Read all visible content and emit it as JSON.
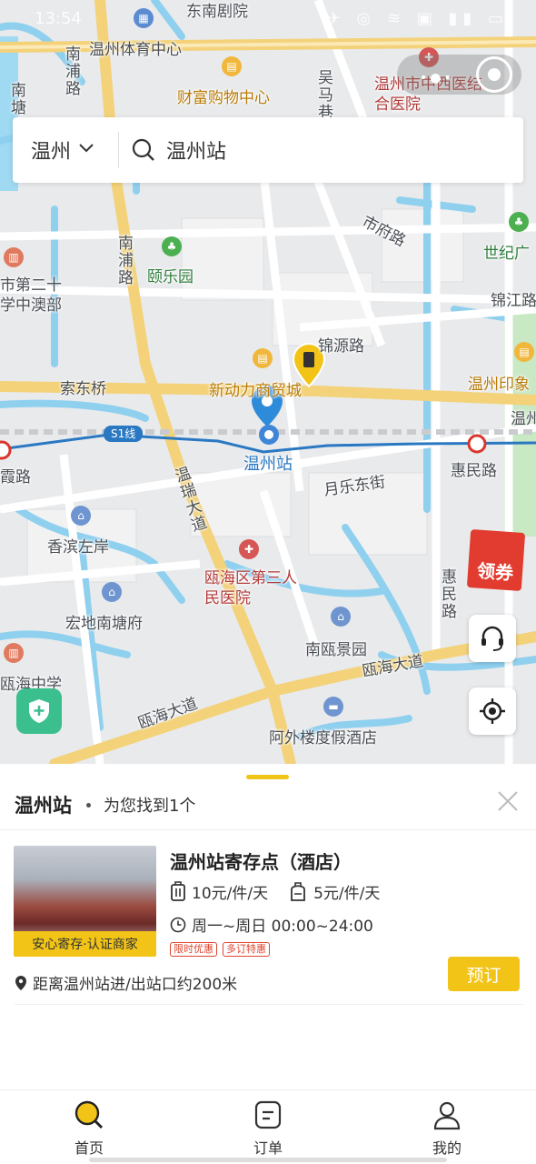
{
  "status_bar": {
    "time": "13:54",
    "icons": "✈ ◎ ≋ ▣ ▮▮ ▭"
  },
  "search": {
    "city": "温州",
    "query": "温州站"
  },
  "map": {
    "labels": {
      "dongnan_theater": "东南剧院",
      "sports_center": "温州体育中心",
      "caifu_mall": "财富购物中心",
      "hospital_tcm": "温州市中西医结合医院",
      "nanpu_road_top": "南浦路",
      "nantang": "南塘",
      "nanpu_road": "南浦路",
      "shifu_road": "市府路",
      "century_park": "世纪广",
      "yile_garden": "颐乐园",
      "school_no20": "市第二十学中澳部",
      "jinjiang_road": "锦江路",
      "jinyuan_road": "锦源路",
      "xindongli_mall": "新动力商贸城",
      "suodong_bridge": "索东桥",
      "wenzhou_impression": "温州印象",
      "wenzhou_right": "温州",
      "line_s1": "S1线",
      "wenzhou_station": "温州站",
      "huimin_road": "惠民路",
      "xia_road": "霞路",
      "yuele_east_st": "月乐东街",
      "wenrui_avenue": "温瑞大道",
      "xiangbin_zuoan": "香滨左岸",
      "hospital_ouhai": "瓯海区第三人民医院",
      "huimin_road_v": "惠民路",
      "hongdi_nantang": "宏地南塘府",
      "nanou_jingyuan": "南瓯景园",
      "ouhai_middle_school": "瓯海中学",
      "ouhai_avenue_right": "瓯海大道",
      "ouhai_avenue_left": "瓯海大道",
      "awaylou_hotel": "阿外楼度假酒店",
      "wuma_road": "吴马巷"
    }
  },
  "coupon": {
    "label": "领券"
  },
  "result": {
    "keyword": "温州站",
    "found_text": "为您找到1个",
    "item": {
      "title": "温州站寄存点（酒店）",
      "badge": "安心寄存·认证商家",
      "price_large": "10元/件/天",
      "price_small": "5元/件/天",
      "hours": "周一~周日 00:00~24:00",
      "tags": [
        "限时优惠",
        "多订特惠"
      ],
      "distance": "距离温州站进/出站口约200米",
      "book_label": "预订"
    }
  },
  "tabs": [
    {
      "label": "首页",
      "icon": "search-icon",
      "active": true
    },
    {
      "label": "订单",
      "icon": "order-icon",
      "active": false
    },
    {
      "label": "我的",
      "icon": "user-icon",
      "active": false
    }
  ],
  "colors": {
    "accent": "#f2c417",
    "metro_line": "#2a78c2",
    "road_major": "#f3d27a"
  }
}
